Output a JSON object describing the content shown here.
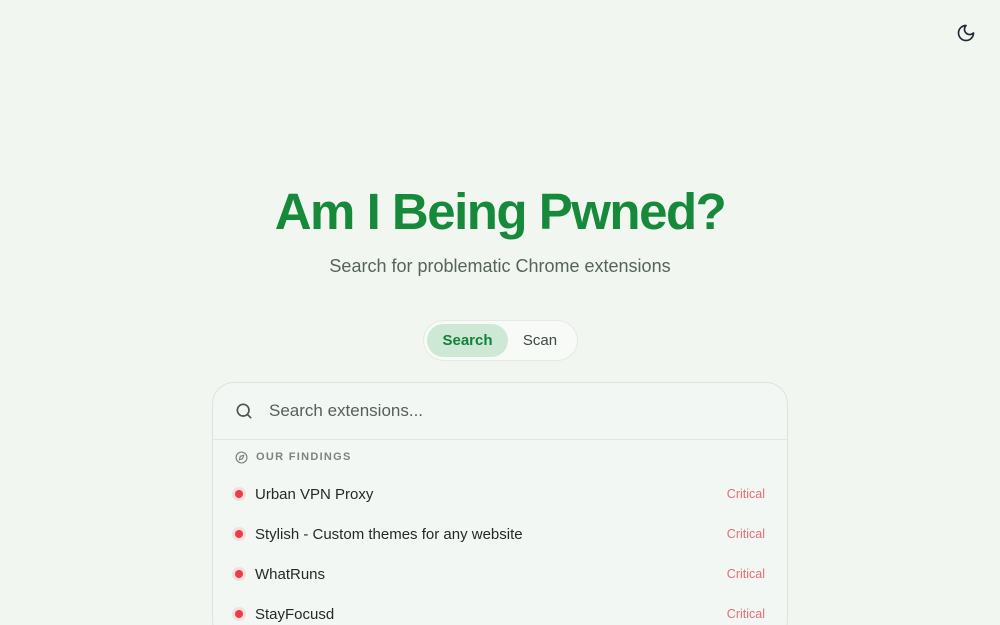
{
  "header": {
    "theme_toggle_icon": "moon-icon"
  },
  "hero": {
    "title": "Am I Being Pwned?",
    "subtitle": "Search for problematic Chrome extensions"
  },
  "mode_tabs": [
    {
      "label": "Search",
      "active": true
    },
    {
      "label": "Scan",
      "active": false
    }
  ],
  "search": {
    "placeholder": "Search extensions...",
    "value": "",
    "icon": "search-icon"
  },
  "findings": {
    "label": "OUR FINDINGS",
    "icon": "compass-icon",
    "items": [
      {
        "name": "Urban VPN Proxy",
        "severity": "Critical"
      },
      {
        "name": "Stylish - Custom themes for any website",
        "severity": "Critical"
      },
      {
        "name": "WhatRuns",
        "severity": "Critical"
      },
      {
        "name": "StayFocusd",
        "severity": "Critical"
      }
    ]
  },
  "colors": {
    "background": "#f1f6f1",
    "brand_green": "#168a3a",
    "active_tab_bg": "#cde8d5",
    "critical_dot": "#ef3b45",
    "critical_text": "#e26d78"
  }
}
